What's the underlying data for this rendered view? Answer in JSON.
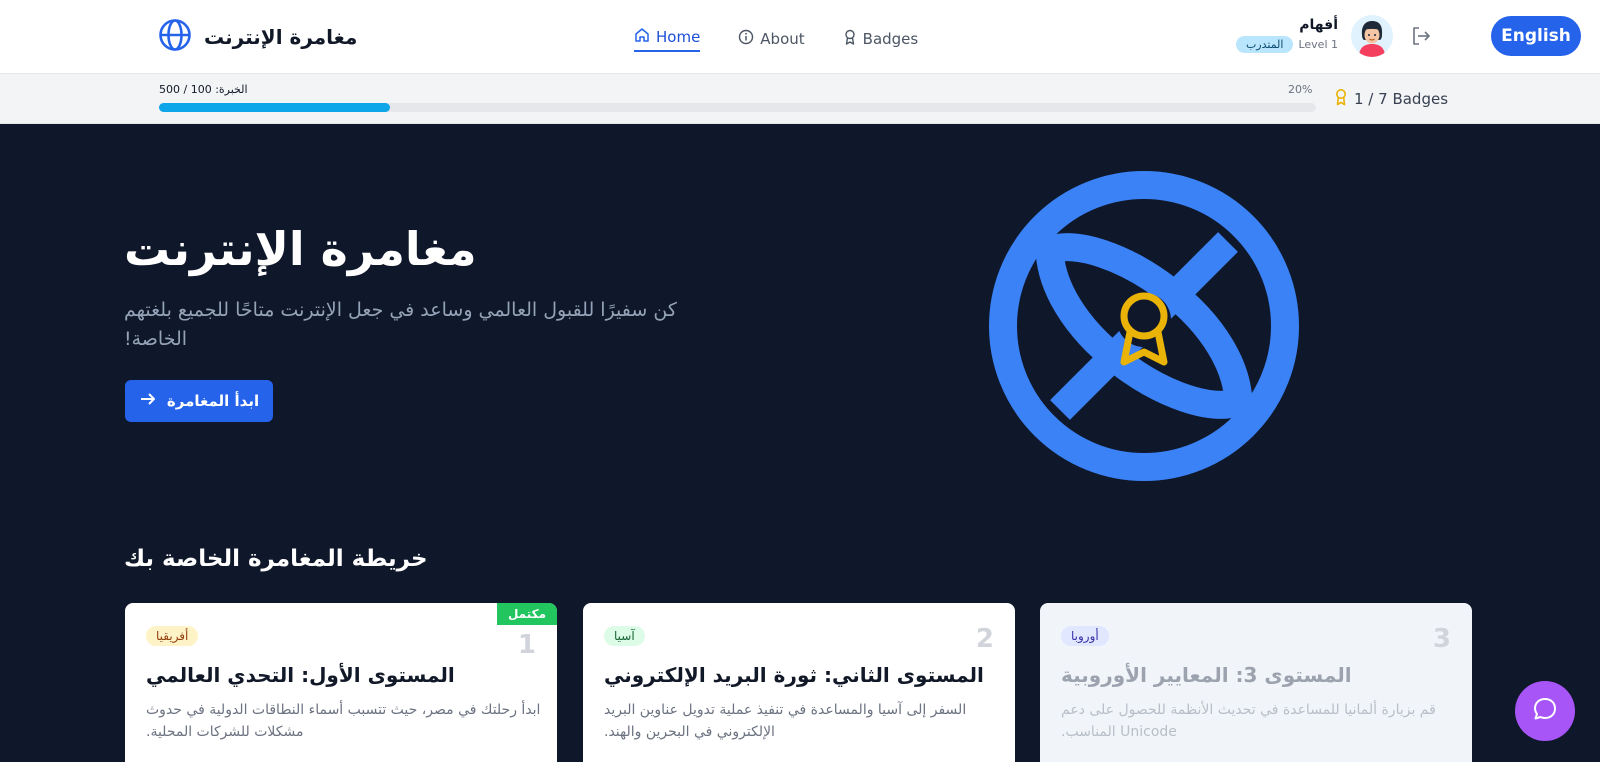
{
  "header": {
    "app_title": "مغامرة الإنترنت",
    "logo_icon": "globe-icon",
    "nav": [
      {
        "label": "Home",
        "icon": "home-icon",
        "active": true
      },
      {
        "label": "About",
        "icon": "info-icon",
        "active": false
      },
      {
        "label": "Badges",
        "icon": "award-icon",
        "active": false
      }
    ],
    "user": {
      "name": "أفهام",
      "rank": "المتدرب",
      "level": "Level 1"
    },
    "language_button": "English"
  },
  "progress": {
    "xp_label": "الخبرة: 100 / 500",
    "percent_label": "20%",
    "fraction": 0.2,
    "badges_label": "1 / 7 Badges"
  },
  "hero": {
    "title": "مغامرة الإنترنت",
    "subtitle": "كن سفيرًا للقبول العالمي وساعد في جعل الإنترنت متاحًا للجميع بلغتهم الخاصة!",
    "cta_label": "ابدأ المغامرة"
  },
  "map": {
    "section_title": "خريطة المغامرة الخاصة بك",
    "cards": [
      {
        "number": "1",
        "region": "أفريقيا",
        "title": "المستوى الأول: التحدي العالمي",
        "description": "ابدأ رحلتك في مصر، حيث تتسبب أسماء النطاقات الدولية في حدوث مشكلات للشركات المحلية.",
        "status": "مكتمل"
      },
      {
        "number": "2",
        "region": "آسيا",
        "title": "المستوى الثاني: ثورة البريد الإلكتروني",
        "description": "السفر إلى آسيا والمساعدة في تنفيذ عملية تدويل عناوين البريد الإلكتروني في البحرين والهند."
      },
      {
        "number": "3",
        "region": "أوروبا",
        "title": "المستوى 3: المعايير الأوروبية",
        "description": "قم بزيارة ألمانيا للمساعدة في تحديث الأنظمة للحصول على دعم Unicode المناسب."
      }
    ]
  },
  "colors": {
    "accent": "#2563eb",
    "hero_bg": "#0f172a",
    "complete": "#22c55e",
    "chat": "#a855f7",
    "medal": "#eab308"
  }
}
